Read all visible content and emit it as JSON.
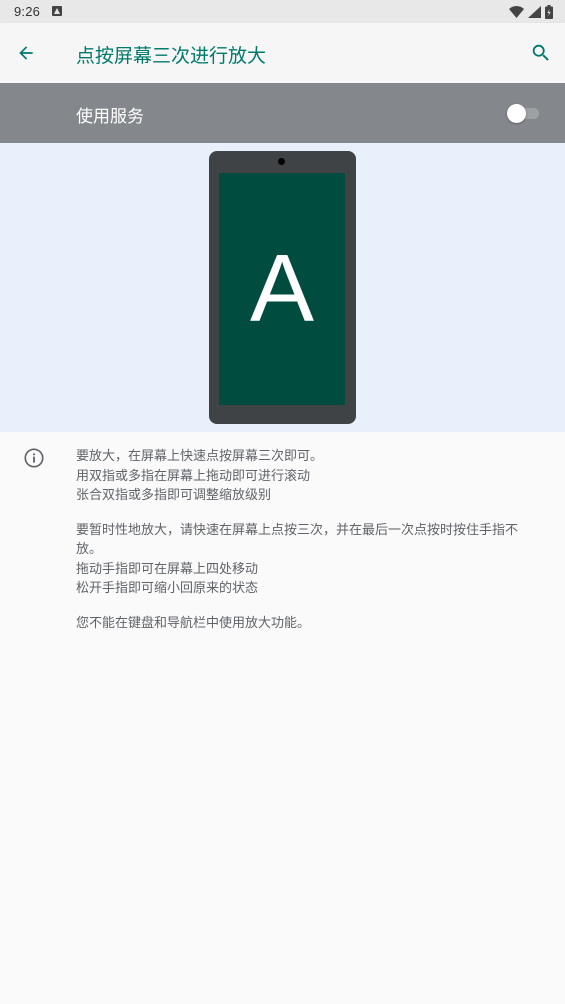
{
  "status_bar": {
    "time": "9:26",
    "icons": [
      "notification-icon",
      "wifi-icon",
      "signal-icon",
      "battery-icon"
    ]
  },
  "app_bar": {
    "title": "点按屏幕三次进行放大",
    "back_icon": "arrow-back-icon",
    "search_icon": "search-icon"
  },
  "service": {
    "label": "使用服务",
    "enabled": false
  },
  "illustration": {
    "letter": "A"
  },
  "description": {
    "para1": [
      "要放大，在屏幕上快速点按屏幕三次即可。",
      "用双指或多指在屏幕上拖动即可进行滚动",
      "张合双指或多指即可调整缩放级别"
    ],
    "para2": [
      "要暂时性地放大，请快速在屏幕上点按三次，并在最后一次点按时按住手指不放。",
      "拖动手指即可在屏幕上四处移动",
      "松开手指即可缩小回原来的状态"
    ],
    "para3": [
      "您不能在键盘和导航栏中使用放大功能。"
    ]
  },
  "colors": {
    "accent": "#00796b",
    "service_row": "#84888c",
    "illustration_bg": "#e8f0fb",
    "phone_screen": "#004d40",
    "phone_body": "#404346"
  }
}
